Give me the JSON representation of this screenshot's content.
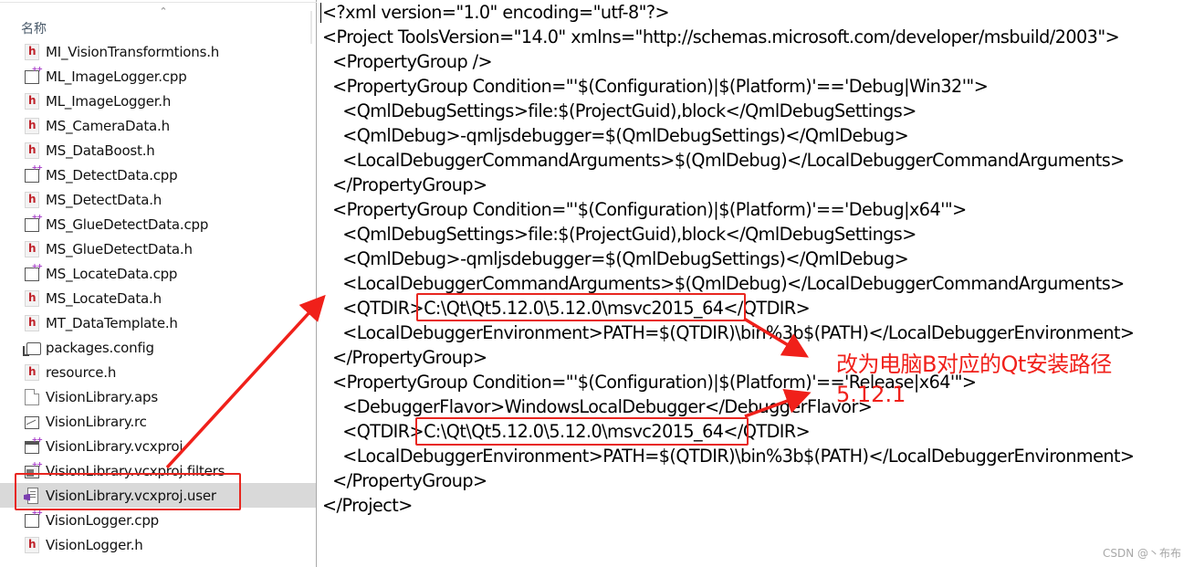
{
  "explorer": {
    "column_header": "名称",
    "sort_indicator": "^",
    "files": [
      {
        "name": "MI_VisionTransformtions.h",
        "icon": "header-file-icon",
        "type": "h"
      },
      {
        "name": "ML_ImageLogger.cpp",
        "icon": "cpp-file-icon",
        "type": "cpp"
      },
      {
        "name": "ML_ImageLogger.h",
        "icon": "header-file-icon",
        "type": "h"
      },
      {
        "name": "MS_CameraData.h",
        "icon": "header-file-icon",
        "type": "h"
      },
      {
        "name": "MS_DataBoost.h",
        "icon": "header-file-icon",
        "type": "h"
      },
      {
        "name": "MS_DetectData.cpp",
        "icon": "cpp-file-icon",
        "type": "cpp"
      },
      {
        "name": "MS_DetectData.h",
        "icon": "header-file-icon",
        "type": "h"
      },
      {
        "name": "MS_GlueDetectData.cpp",
        "icon": "cpp-file-icon",
        "type": "cpp"
      },
      {
        "name": "MS_GlueDetectData.h",
        "icon": "header-file-icon",
        "type": "h"
      },
      {
        "name": "MS_LocateData.cpp",
        "icon": "cpp-file-icon",
        "type": "cpp"
      },
      {
        "name": "MS_LocateData.h",
        "icon": "header-file-icon",
        "type": "h"
      },
      {
        "name": "MT_DataTemplate.h",
        "icon": "header-file-icon",
        "type": "h"
      },
      {
        "name": "packages.config",
        "icon": "config-file-icon",
        "type": "config"
      },
      {
        "name": "resource.h",
        "icon": "header-file-icon",
        "type": "h"
      },
      {
        "name": "VisionLibrary.aps",
        "icon": "blank-file-icon",
        "type": "doc"
      },
      {
        "name": "VisionLibrary.rc",
        "icon": "image-resource-icon",
        "type": "img"
      },
      {
        "name": "VisionLibrary.vcxproj",
        "icon": "vcxproj-file-icon",
        "type": "proj"
      },
      {
        "name": "VisionLibrary.vcxproj.filters",
        "icon": "filters-file-icon",
        "type": "filters"
      },
      {
        "name": "VisionLibrary.vcxproj.user",
        "icon": "visual-studio-user-file-icon",
        "type": "user",
        "selected": true
      },
      {
        "name": "VisionLogger.cpp",
        "icon": "cpp-file-icon",
        "type": "cpp"
      },
      {
        "name": "VisionLogger.h",
        "icon": "header-file-icon",
        "type": "h"
      }
    ]
  },
  "editor": {
    "lines": [
      "<?xml version=\"1.0\" encoding=\"utf-8\"?>",
      "<Project ToolsVersion=\"14.0\" xmlns=\"http://schemas.microsoft.com/developer/msbuild/2003\">",
      "  <PropertyGroup />",
      "  <PropertyGroup Condition=\"'$(Configuration)|$(Platform)'=='Debug|Win32'\">",
      "    <QmlDebugSettings>file:$(ProjectGuid),block</QmlDebugSettings>",
      "    <QmlDebug>-qmljsdebugger=$(QmlDebugSettings)</QmlDebug>",
      "    <LocalDebuggerCommandArguments>$(QmlDebug)</LocalDebuggerCommandArguments>",
      "  </PropertyGroup>",
      "  <PropertyGroup Condition=\"'$(Configuration)|$(Platform)'=='Debug|x64'\">",
      "    <QmlDebugSettings>file:$(ProjectGuid),block</QmlDebugSettings>",
      "    <QmlDebug>-qmljsdebugger=$(QmlDebugSettings)</QmlDebug>",
      "    <LocalDebuggerCommandArguments>$(QmlDebug)</LocalDebuggerCommandArguments>",
      "    <QTDIR>C:\\Qt\\Qt5.12.0\\5.12.0\\msvc2015_64</QTDIR>",
      "    <LocalDebuggerEnvironment>PATH=$(QTDIR)\\bin%3b$(PATH)</LocalDebuggerEnvironment>",
      "  </PropertyGroup>",
      "  <PropertyGroup Condition=\"'$(Configuration)|$(Platform)'=='Release|x64'\">",
      "    <DebuggerFlavor>WindowsLocalDebugger</DebuggerFlavor>",
      "    <QTDIR>C:\\Qt\\Qt5.12.0\\5.12.0\\msvc2015_64</QTDIR>",
      "    <LocalDebuggerEnvironment>PATH=$(QTDIR)\\bin%3b$(PATH)</LocalDebuggerEnvironment>",
      "  </PropertyGroup>",
      "</Project>"
    ]
  },
  "annotations": {
    "note_line1": "改为电脑B对应的Qt安装路径",
    "note_line2": "5.12.1",
    "highlight_color": "#e8261f",
    "highlighted_path": "C:\\Qt\\Qt5.12.0\\5.12.0\\msvc2015_64"
  },
  "watermark": "CSDN @丶布布"
}
